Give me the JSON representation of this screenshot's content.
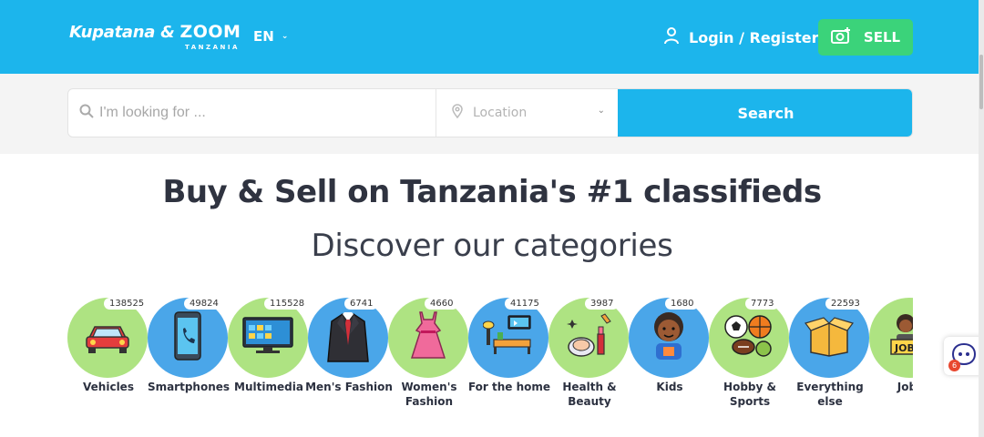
{
  "header": {
    "brand_part1": "Kupatana",
    "brand_amp": " & ",
    "brand_part2": "ZOOM",
    "brand_sub": "TANZANIA",
    "language": "EN",
    "login_label": "Login / Register",
    "sell_label": "SELL"
  },
  "search": {
    "query_placeholder": "I'm looking for ...",
    "location_placeholder": "Location",
    "button_label": "Search"
  },
  "headline": "Buy & Sell on Tanzania's #1 classifieds",
  "subheadline": "Discover our categories",
  "categories": [
    {
      "label": "Vehicles",
      "count": "138525",
      "icon": "car-icon",
      "bg": "green"
    },
    {
      "label": "Smartphones",
      "count": "49824",
      "icon": "smartphone-icon",
      "bg": "blue"
    },
    {
      "label": "Multimedia",
      "count": "115528",
      "icon": "tv-icon",
      "bg": "green"
    },
    {
      "label": "Men's Fashion",
      "count": "6741",
      "icon": "suit-icon",
      "bg": "blue"
    },
    {
      "label": "Women's Fashion",
      "count": "4660",
      "icon": "dress-icon",
      "bg": "green"
    },
    {
      "label": "For the home",
      "count": "41175",
      "icon": "home-furniture-icon",
      "bg": "blue"
    },
    {
      "label": "Health & Beauty",
      "count": "3987",
      "icon": "cosmetics-icon",
      "bg": "green"
    },
    {
      "label": "Kids",
      "count": "1680",
      "icon": "child-icon",
      "bg": "blue"
    },
    {
      "label": "Hobby & Sports",
      "count": "7773",
      "icon": "sports-balls-icon",
      "bg": "green"
    },
    {
      "label": "Everything else",
      "count": "22593",
      "icon": "box-icon",
      "bg": "blue"
    },
    {
      "label": "Jobs",
      "count": "",
      "icon": "job-sign-icon",
      "bg": "green"
    }
  ],
  "chat_badge": "6",
  "colors": {
    "primary": "#1cb5ec",
    "sell": "#3bd37a",
    "green_circle": "#aee382",
    "blue_circle": "#4aa6e9"
  }
}
